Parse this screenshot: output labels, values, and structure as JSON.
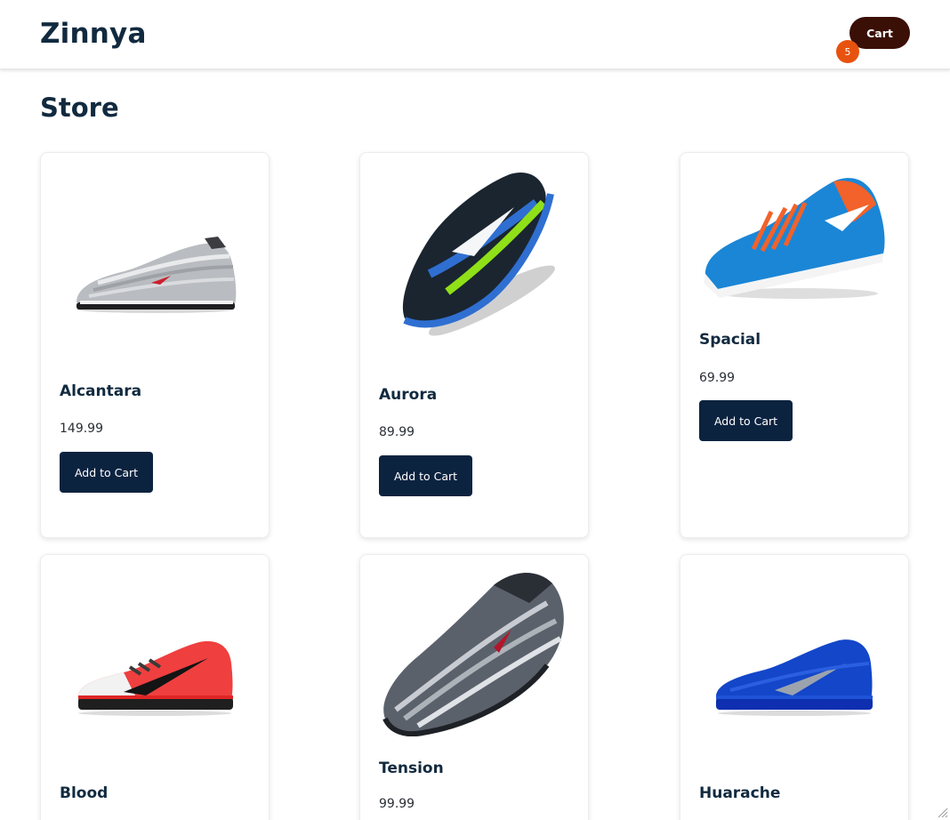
{
  "header": {
    "brand": "Zinnya",
    "cart_label": "Cart",
    "cart_count": "5"
  },
  "page": {
    "title": "Store"
  },
  "products": [
    {
      "name": "Alcantara",
      "price": "149.99",
      "button": "Add to Cart",
      "image_icon": "shoe-silver-icon"
    },
    {
      "name": "Aurora",
      "price": "89.99",
      "button": "Add to Cart",
      "image_icon": "shoe-black-lime-icon"
    },
    {
      "name": "Spacial",
      "price": "69.99",
      "button": "Add to Cart",
      "image_icon": "shoe-blue-orange-icon"
    },
    {
      "name": "Blood",
      "price": "",
      "button": "",
      "image_icon": "shoe-red-icon"
    },
    {
      "name": "Tension",
      "price": "99.99",
      "button": "",
      "image_icon": "shoe-metallic-icon"
    },
    {
      "name": "Huarache",
      "price": "",
      "button": "",
      "image_icon": "shoe-royal-blue-icon"
    }
  ],
  "colors": {
    "brand_text": "#112a3f",
    "cart_button": "#3a0f06",
    "badge": "#e8520f",
    "add_button": "#0c2340"
  }
}
